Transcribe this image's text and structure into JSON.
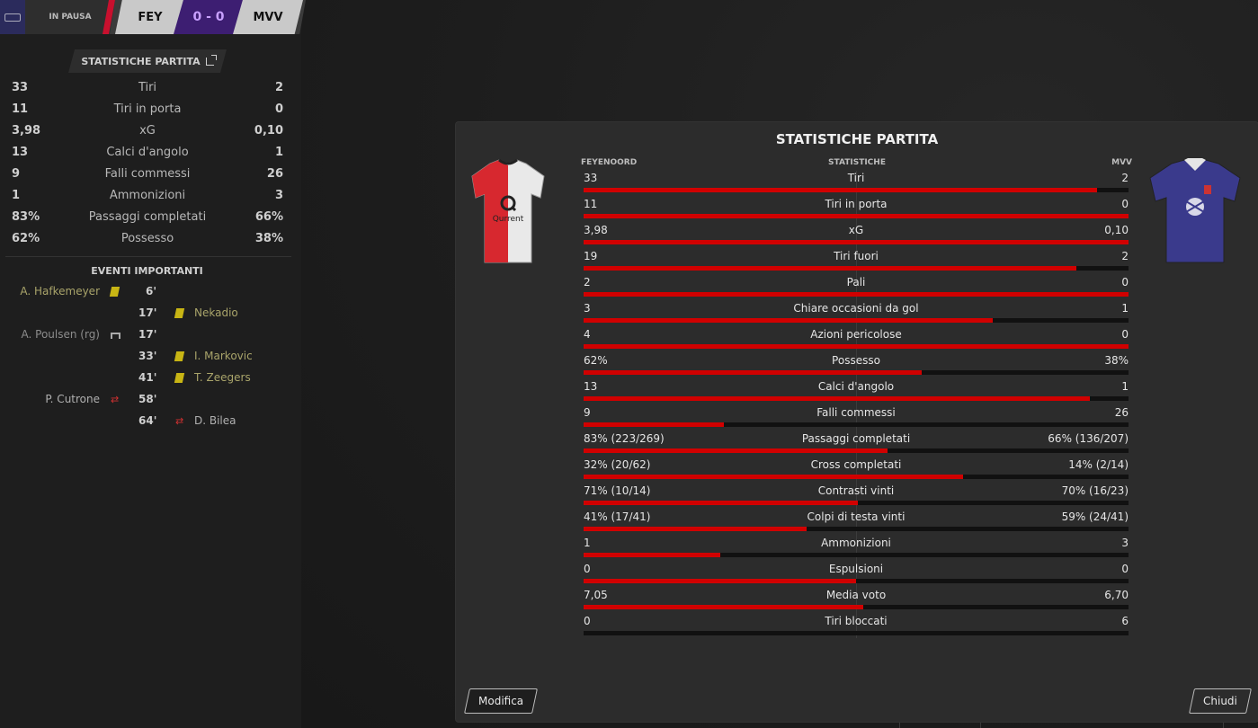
{
  "scorebar": {
    "status": "IN PAUSA",
    "home_abbr": "FEY",
    "score": "0 - 0",
    "away_abbr": "MVV"
  },
  "left": {
    "tab_label": "STATISTICHE PARTITA",
    "stats": [
      {
        "home": "33",
        "name": "Tiri",
        "away": "2"
      },
      {
        "home": "11",
        "name": "Tiri in porta",
        "away": "0"
      },
      {
        "home": "3,98",
        "name": "xG",
        "away": "0,10"
      },
      {
        "home": "13",
        "name": "Calci d'angolo",
        "away": "1"
      },
      {
        "home": "9",
        "name": "Falli commessi",
        "away": "26"
      },
      {
        "home": "1",
        "name": "Ammonizioni",
        "away": "3"
      },
      {
        "home": "83%",
        "name": "Passaggi completati",
        "away": "66%"
      },
      {
        "home": "62%",
        "name": "Possesso",
        "away": "38%"
      }
    ],
    "events_title": "EVENTI IMPORTANTI",
    "events": [
      {
        "side": "home",
        "player": "A. Hafkemeyer",
        "minute": "6'",
        "icon": "yellow-card-icon"
      },
      {
        "side": "away",
        "player": "Nekadio",
        "minute": "17'",
        "icon": "yellow-card-icon"
      },
      {
        "side": "home",
        "player": "A. Poulsen (rg)",
        "minute": "17'",
        "icon": "own-goal-icon"
      },
      {
        "side": "away",
        "player": "I. Markovic",
        "minute": "33'",
        "icon": "yellow-card-icon"
      },
      {
        "side": "away",
        "player": "T. Zeegers",
        "minute": "41'",
        "icon": "yellow-card-icon"
      },
      {
        "side": "home",
        "player": "P. Cutrone",
        "minute": "58'",
        "icon": "substitution-icon"
      },
      {
        "side": "away",
        "player": "D. Bilea",
        "minute": "64'",
        "icon": "substitution-icon"
      }
    ]
  },
  "modal": {
    "title": "STATISTICHE PARTITA",
    "home_team": "FEYENOORD",
    "stats_header": "STATISTICHE",
    "away_team": "MVV",
    "home_sponsor": "Qurrent",
    "stats": [
      {
        "home": "33",
        "name": "Tiri",
        "away": "2",
        "share": 0.943
      },
      {
        "home": "11",
        "name": "Tiri in porta",
        "away": "0",
        "share": 1.0
      },
      {
        "home": "3,98",
        "name": "xG",
        "away": "0,10",
        "share": 1.0
      },
      {
        "home": "19",
        "name": "Tiri fuori",
        "away": "2",
        "share": 0.905
      },
      {
        "home": "2",
        "name": "Pali",
        "away": "0",
        "share": 1.0
      },
      {
        "home": "3",
        "name": "Chiare occasioni da gol",
        "away": "1",
        "share": 0.75
      },
      {
        "home": "4",
        "name": "Azioni pericolose",
        "away": "0",
        "share": 1.0
      },
      {
        "home": "62%",
        "name": "Possesso",
        "away": "38%",
        "share": 0.62
      },
      {
        "home": "13",
        "name": "Calci d'angolo",
        "away": "1",
        "share": 0.929
      },
      {
        "home": "9",
        "name": "Falli commessi",
        "away": "26",
        "share": 0.257
      },
      {
        "home": "83% (223/269)",
        "name": "Passaggi completati",
        "away": "66% (136/207)",
        "share": 0.557
      },
      {
        "home": "32% (20/62)",
        "name": "Cross completati",
        "away": "14% (2/14)",
        "share": 0.696
      },
      {
        "home": "71% (10/14)",
        "name": "Contrasti vinti",
        "away": "70% (16/23)",
        "share": 0.504
      },
      {
        "home": "41% (17/41)",
        "name": "Colpi di testa vinti",
        "away": "59% (24/41)",
        "share": 0.41
      },
      {
        "home": "1",
        "name": "Ammonizioni",
        "away": "3",
        "share": 0.25
      },
      {
        "home": "0",
        "name": "Espulsioni",
        "away": "0",
        "share": 0.5
      },
      {
        "home": "7,05",
        "name": "Media voto",
        "away": "6,70",
        "share": 0.513
      },
      {
        "home": "0",
        "name": "Tiri bloccati",
        "away": "6",
        "share": 0.0
      }
    ],
    "edit_label": "Modifica",
    "close_label": "Chiudi"
  },
  "colors": {
    "home_bar": "#d10000",
    "away_bar": "#111111",
    "score_bg": "#3d1e72",
    "home_stripe": "#c8102e"
  }
}
